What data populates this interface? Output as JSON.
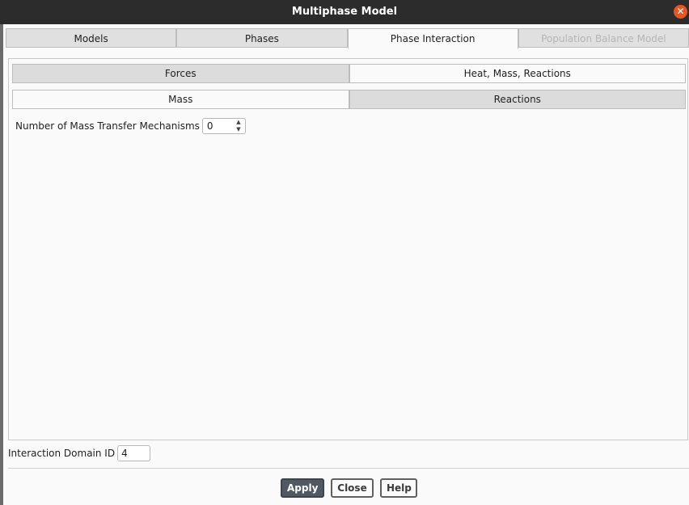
{
  "window": {
    "title": "Multiphase Model"
  },
  "main_tabs": [
    {
      "label": "Models",
      "state": "normal"
    },
    {
      "label": "Phases",
      "state": "normal"
    },
    {
      "label": "Phase Interaction",
      "state": "active"
    },
    {
      "label": "Population Balance Model",
      "state": "disabled"
    }
  ],
  "subtabs_row1": [
    {
      "label": "Forces"
    },
    {
      "label": "Heat, Mass, Reactions"
    }
  ],
  "subtabs_row2": [
    {
      "label": "Mass"
    },
    {
      "label": "Reactions"
    }
  ],
  "mass": {
    "mechanisms_label": "Number of Mass Transfer Mechanisms",
    "mechanisms_value": "0"
  },
  "interaction_domain": {
    "label": "Interaction Domain ID",
    "value": "4"
  },
  "buttons": {
    "apply": "Apply",
    "close": "Close",
    "help": "Help"
  },
  "icons": {
    "close": "close-icon",
    "spin": "spin-arrows-icon"
  },
  "colors": {
    "titlebar": "#2c2c2c",
    "close_accent": "#e95420",
    "apply_button": "#505863"
  }
}
